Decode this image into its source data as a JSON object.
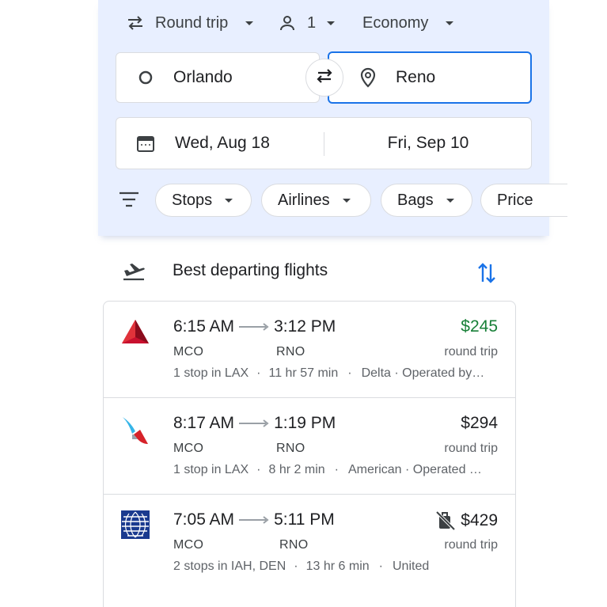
{
  "search": {
    "trip_type": "Round trip",
    "passengers": "1",
    "cabin": "Economy",
    "origin": "Orlando",
    "destination": "Reno",
    "depart_date": "Wed, Aug 18",
    "return_date": "Fri, Sep 10"
  },
  "filters": {
    "chips": [
      "Stops",
      "Airlines",
      "Bags",
      "Price"
    ]
  },
  "results": {
    "heading": "Best departing flights",
    "flights": [
      {
        "depart": "6:15 AM",
        "arrive": "3:12 PM",
        "from": "MCO",
        "to": "RNO",
        "stops": "1 stop in LAX",
        "duration": "11 hr 57 min",
        "airline": "Delta · Operated by…",
        "price": "$245",
        "price_type": "round trip",
        "price_color": "#188038"
      },
      {
        "depart": "8:17 AM",
        "arrive": "1:19 PM",
        "from": "MCO",
        "to": "RNO",
        "stops": "1 stop in LAX",
        "duration": "8 hr 2 min",
        "airline": "American · Operated …",
        "price": "$294",
        "price_type": "round trip"
      },
      {
        "depart": "7:05 AM",
        "arrive": "5:11 PM",
        "from": "MCO",
        "to": "RNO",
        "stops": "2 stops in IAH, DEN",
        "duration": "13 hr 6 min",
        "airline": "United",
        "price": "$429",
        "price_type": "round trip",
        "price_icon": "no-carry-on-bag-icon"
      }
    ]
  },
  "colors": {
    "accent": "#1a73e8",
    "panel_bg": "#e8efff",
    "price_green": "#188038"
  }
}
